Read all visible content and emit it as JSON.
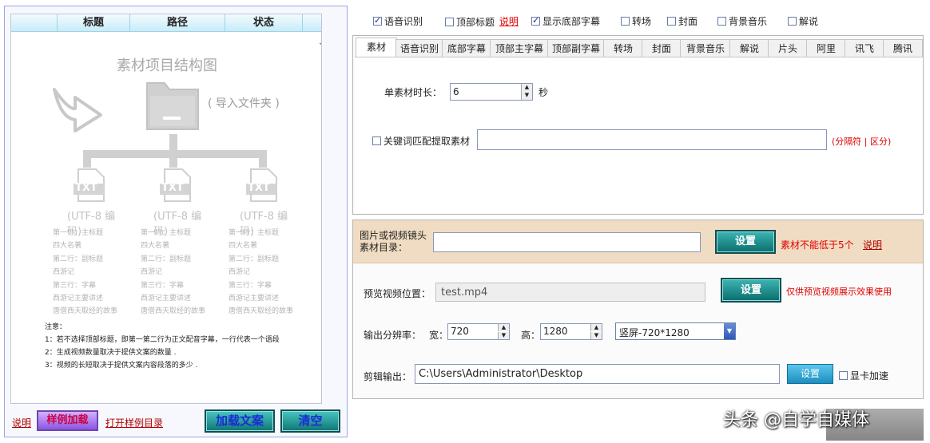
{
  "left_panel": {
    "columns": [
      "标题",
      "路径",
      "状态"
    ],
    "diagram": {
      "title": "素材项目结构图",
      "import_hint": "( 导入文件夹 )",
      "file_label": "TXT",
      "encoding": "(UTF-8 编码)",
      "file_lines": [
        "第一行：主标题",
        "四大名著",
        "第二行：副标题",
        "西游记",
        "第三行：字幕",
        "西游记主要讲述",
        "唐僧西天取经的故事"
      ]
    },
    "notes": {
      "title": "注意：",
      "lines": [
        "1：若不选择顶部标题，即第一第二行为正文配音字幕，一行代表一个语段",
        "2：生成视频数量取决于提供文案的数量 .",
        "3：视频的长短取决于提供文案内容段落的多少 ."
      ]
    },
    "bottom": {
      "help_link": "说明",
      "sample_load": "样例加载",
      "open_sample_dir": "打开样例目录",
      "load_text": "加载文案",
      "clear": "清空"
    }
  },
  "options": {
    "items": [
      {
        "label": "语音识别",
        "checked": true
      },
      {
        "label": "顶部标题",
        "checked": false
      },
      {
        "label": "显示底部字幕",
        "checked": true
      },
      {
        "label": "转场",
        "checked": false
      },
      {
        "label": "封面",
        "checked": false
      },
      {
        "label": "背景音乐",
        "checked": false
      },
      {
        "label": "解说",
        "checked": false
      }
    ],
    "help_link": "说明"
  },
  "tabs": [
    "素材",
    "语音识别",
    "底部字幕",
    "顶部主字幕",
    "顶部副字幕",
    "转场",
    "封面",
    "背景音乐",
    "解说",
    "片头",
    "阿里",
    "讯飞",
    "腾讯"
  ],
  "material_tab": {
    "duration_label": "单素材时长：",
    "duration_value": "6",
    "duration_unit": "秒",
    "keyword_label": "关键词匹配提取素材",
    "keyword_value": "",
    "keyword_hint": "(分隔符 | 区分)"
  },
  "output": {
    "media_dir_label": "图片或视频镜头素材目录：",
    "media_dir_value": "",
    "media_set": "设置",
    "media_warning": "素材不能低于5个",
    "media_help": "说明",
    "preview_label": "预览视频位置：",
    "preview_value": "test.mp4",
    "preview_set": "设置",
    "preview_note": "仅供预览视频展示效果使用",
    "resolution_label": "输出分辨率：",
    "width_label": "宽：",
    "width_value": "720",
    "height_label": "高：",
    "height_value": "1280",
    "preset_value": "竖屏-720*1280",
    "export_label": "剪辑输出：",
    "export_value": "C:\\Users\\Administrator\\Desktop",
    "export_set": "设置",
    "gpu_label": "显卡加速"
  },
  "watermark": "头条 @自学自媒体",
  "colors": {
    "accent_teal": "#0a6e6d",
    "warning_red": "#e00000",
    "band": "#f0dcc2"
  }
}
